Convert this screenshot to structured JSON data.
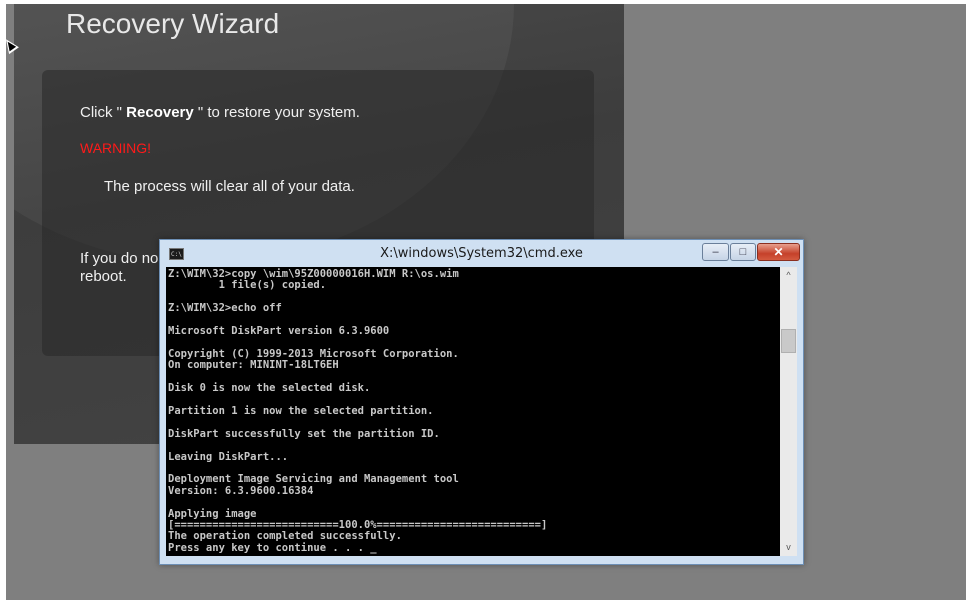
{
  "wizard": {
    "title": "Recovery Wizard",
    "click_prefix": "Click \" ",
    "recovery_bold": "Recovery",
    "click_suffix": " \" to restore your system.",
    "warning": "WARNING!",
    "process_text": "The process will clear all of your data.",
    "if_you_do": "If you do no reboot."
  },
  "cmd": {
    "title": "X:\\windows\\System32\\cmd.exe",
    "icon_label": "C:\\",
    "buttons": {
      "minimize": "–",
      "maximize": "□",
      "close": "✕"
    },
    "lines": [
      "Z:\\WIM\\32>copy \\wim\\95Z00000016H.WIM R:\\os.wim",
      "        1 file(s) copied.",
      "",
      "Z:\\WIM\\32>echo off",
      "",
      "Microsoft DiskPart version 6.3.9600",
      "",
      "Copyright (C) 1999-2013 Microsoft Corporation.",
      "On computer: MININT-18LT6EH",
      "",
      "Disk 0 is now the selected disk.",
      "",
      "Partition 1 is now the selected partition.",
      "",
      "DiskPart successfully set the partition ID.",
      "",
      "Leaving DiskPart...",
      "",
      "Deployment Image Servicing and Management tool",
      "Version: 6.3.9600.16384",
      "",
      "Applying image",
      "[==========================100.0%==========================]",
      "The operation completed successfully.",
      "Press any key to continue . . . _"
    ],
    "scroll_up": "^",
    "scroll_down": "v"
  }
}
